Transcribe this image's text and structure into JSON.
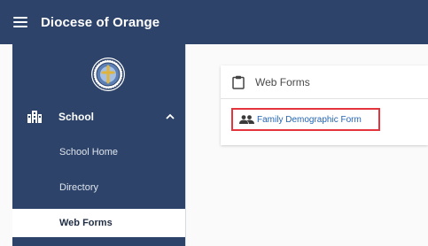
{
  "header": {
    "title": "Diocese of Orange"
  },
  "sidebar": {
    "section": {
      "label": "School"
    },
    "items": [
      {
        "label": "School Home"
      },
      {
        "label": "Directory"
      },
      {
        "label": "Web Forms",
        "active": true
      }
    ]
  },
  "main": {
    "card": {
      "title": "Web Forms",
      "forms": [
        {
          "label": "Family Demographic Form"
        }
      ]
    }
  },
  "colors": {
    "primary": "#2d4369",
    "link": "#2364b5",
    "highlight_border": "#e4343d"
  },
  "icons": [
    "menu-icon",
    "diocese-logo",
    "school-icon",
    "chevron-up-icon",
    "clipboard-icon",
    "people-icon"
  ]
}
